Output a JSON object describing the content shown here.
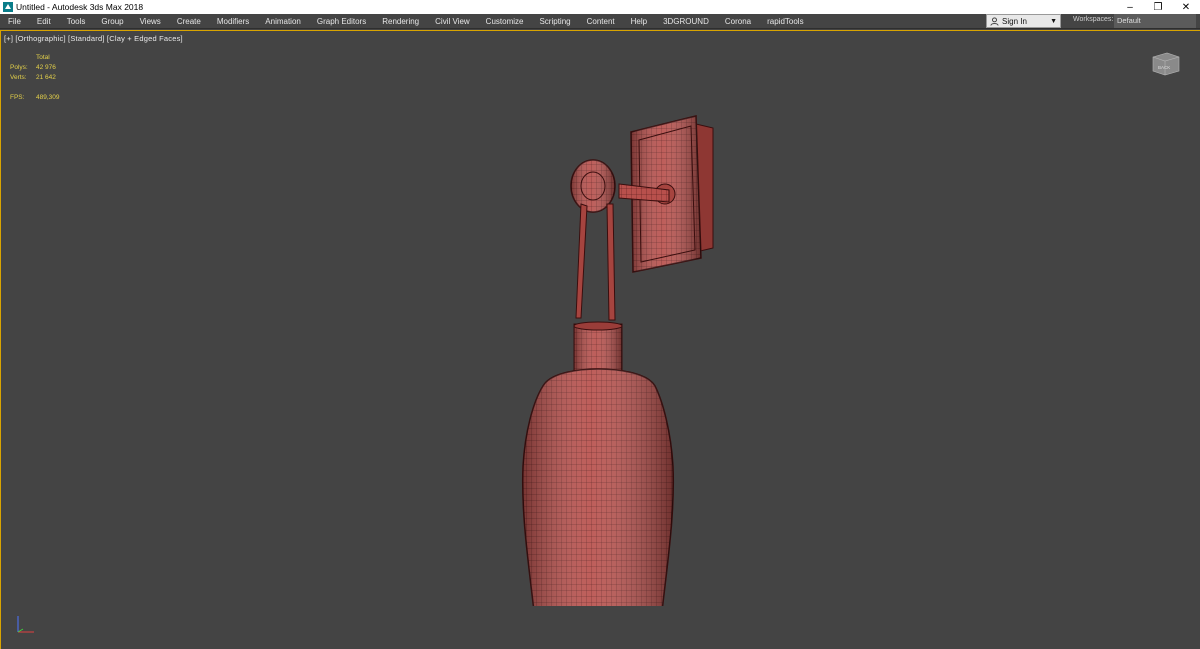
{
  "window": {
    "title": "Untitled - Autodesk 3ds Max 2018",
    "minimize_icon": "minimize-icon",
    "maximize_icon": "restore-icon",
    "close_icon": "close-icon"
  },
  "menu": {
    "items": [
      "File",
      "Edit",
      "Tools",
      "Group",
      "Views",
      "Create",
      "Modifiers",
      "Animation",
      "Graph Editors",
      "Rendering",
      "Civil View",
      "Customize",
      "Scripting",
      "Content",
      "Help",
      "3DGROUND",
      "Corona",
      "rapidTools"
    ]
  },
  "signin": {
    "label": "Sign In",
    "icon": "user-icon"
  },
  "workspaces": {
    "label": "Workspaces:",
    "value": "Default"
  },
  "viewport": {
    "label": "[+] [Orthographic] [Standard] [Clay + Edged Faces]",
    "stats": {
      "header": "Total",
      "polys_label": "Polys:",
      "polys_value": "42 976",
      "verts_label": "Verts:",
      "verts_value": "21 642",
      "fps_label": "FPS:",
      "fps_value": "489,309"
    },
    "viewcube_label": "BACK"
  },
  "colors": {
    "accent": "#d9a400",
    "viewport_bg": "#444444",
    "stats_text": "#e3d04a",
    "mesh_fill": "#b8504c",
    "mesh_wire": "#4a1414"
  }
}
